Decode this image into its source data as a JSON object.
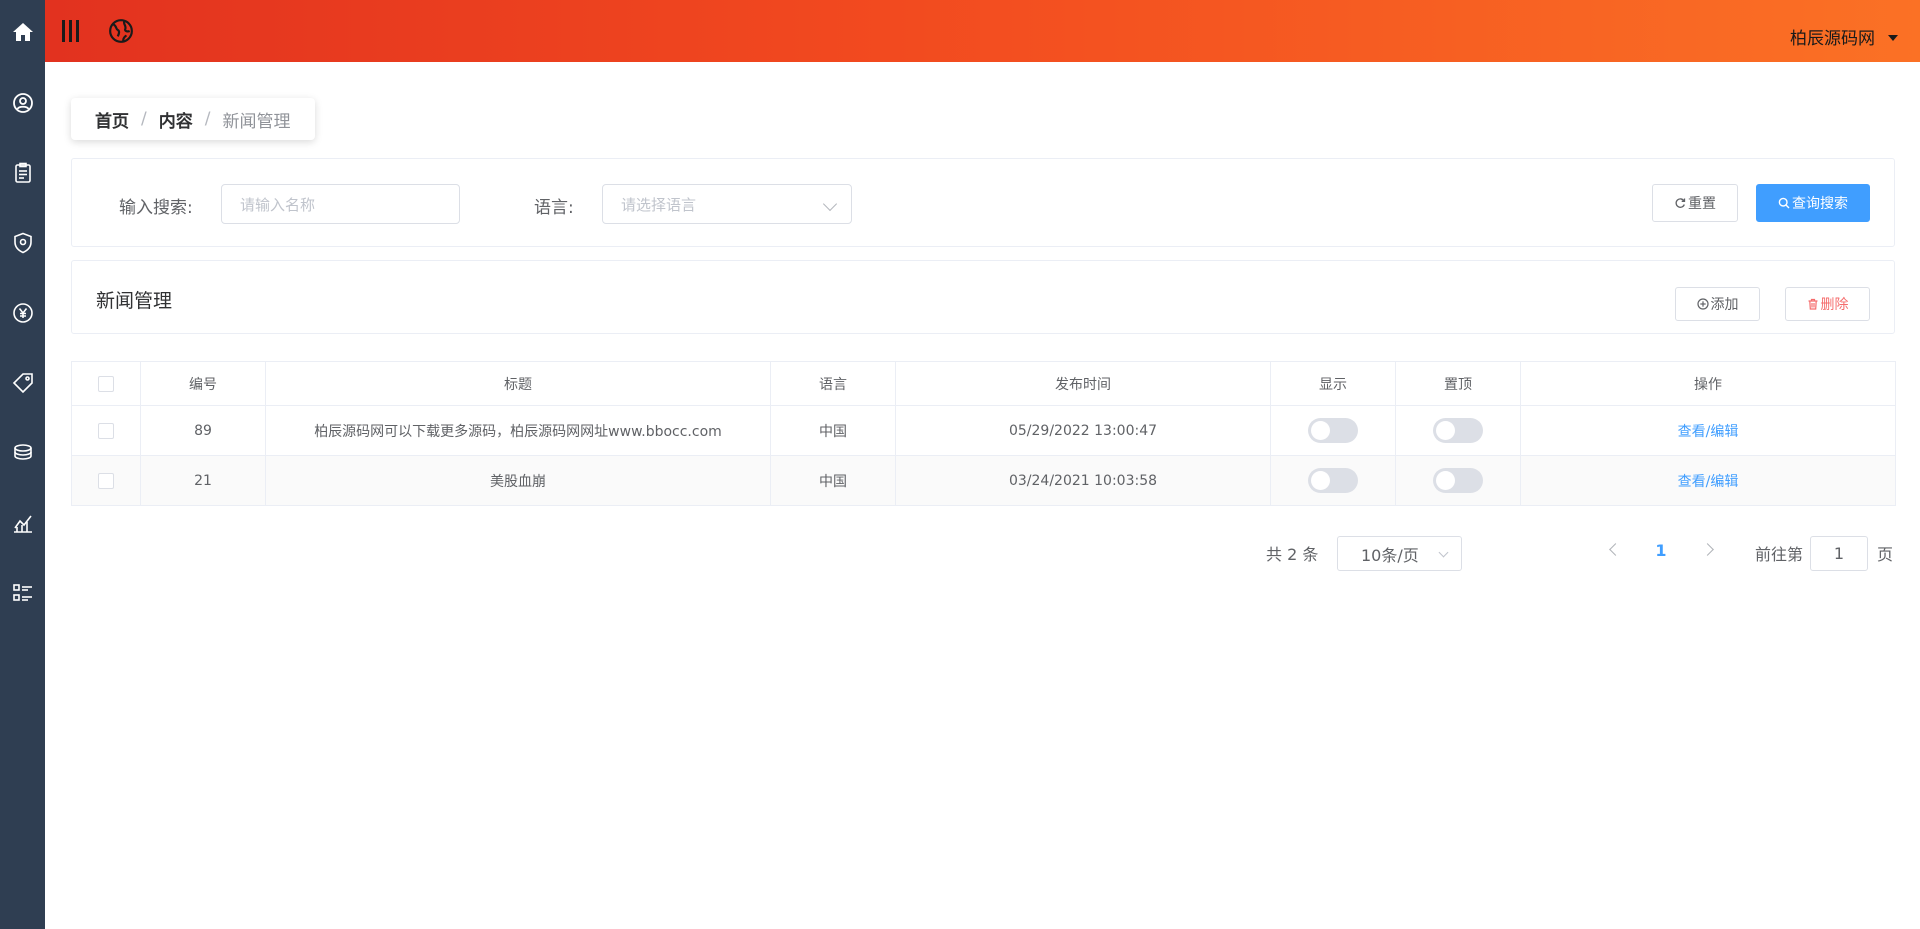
{
  "sidebar": {
    "icons": [
      "home-icon",
      "user-icon",
      "clipboard-icon",
      "shield-icon",
      "yen-icon",
      "tag-icon",
      "coins-icon",
      "trend-chart-icon",
      "list-icon"
    ]
  },
  "topbar": {
    "user_name": "柏辰源码网"
  },
  "breadcrumb": {
    "home": "首页",
    "section": "内容",
    "current": "新闻管理",
    "separator": "/"
  },
  "search": {
    "keyword_label": "输入搜索:",
    "keyword_placeholder": "请输入名称",
    "language_label": "语言:",
    "language_placeholder": "请选择语言",
    "reset_label": "重置",
    "search_label": "查询搜索"
  },
  "list": {
    "title": "新闻管理",
    "add_label": "添加",
    "delete_label": "删除"
  },
  "table": {
    "columns": [
      "编号",
      "标题",
      "语言",
      "发布时间",
      "显示",
      "置顶",
      "操作"
    ],
    "rows": [
      {
        "id": "89",
        "title": "柏辰源码网可以下载更多源码，柏辰源码网网址www.bbocc.com",
        "language": "中国",
        "publish_time": "05/29/2022 13:00:47",
        "show": false,
        "top": false,
        "action": "查看/编辑"
      },
      {
        "id": "21",
        "title": "美股血崩",
        "language": "中国",
        "publish_time": "03/24/2021 10:03:58",
        "show": false,
        "top": false,
        "action": "查看/编辑"
      }
    ]
  },
  "pagination": {
    "total_text": "共 2 条",
    "page_size": "10条/页",
    "current_page": "1",
    "goto_prefix": "前往第",
    "goto_value": "1",
    "goto_suffix": "页"
  },
  "colors": {
    "sidebar": "#2f3e52",
    "header_start": "#e2321f",
    "header_end": "#fb7125",
    "primary": "#409eff",
    "danger": "#f56c6c"
  }
}
